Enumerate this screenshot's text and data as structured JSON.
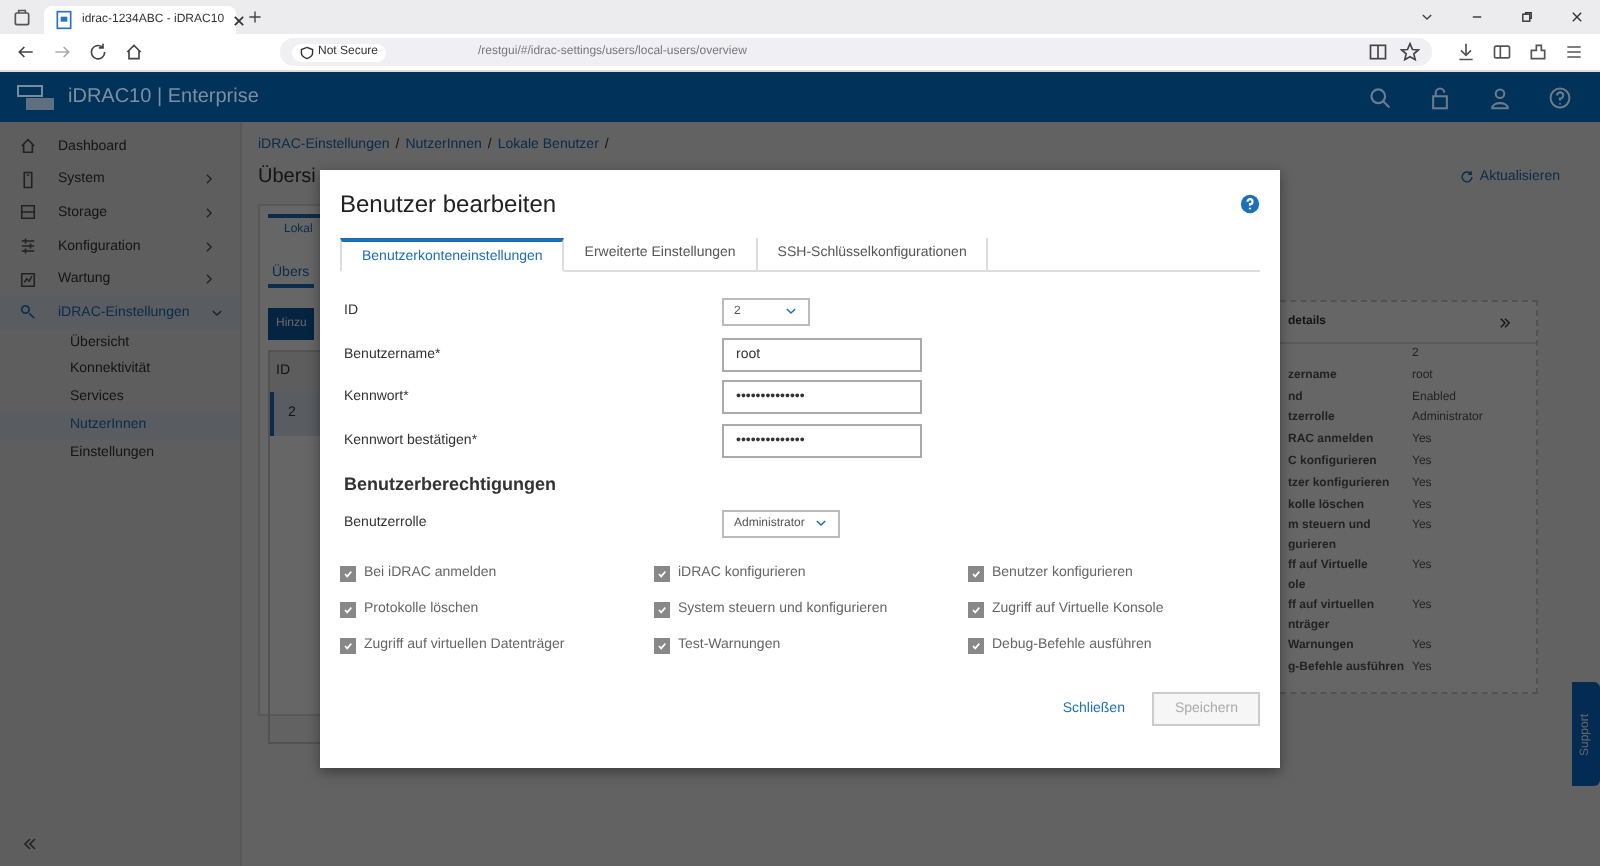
{
  "browser": {
    "tab_title": "idrac-1234ABC - iDRAC10",
    "security": "Not Secure",
    "url": "/restgui/#/idrac-settings/users/local-users/overview"
  },
  "header": {
    "product": "iDRAC10 | Enterprise"
  },
  "sidebar": {
    "items": [
      {
        "label": "Dashboard",
        "expandable": false,
        "selected": false
      },
      {
        "label": "System",
        "expandable": true,
        "expanded": false,
        "selected": false
      },
      {
        "label": "Storage",
        "expandable": true,
        "expanded": false,
        "selected": false
      },
      {
        "label": "Konfiguration",
        "expandable": true,
        "expanded": false,
        "selected": false
      },
      {
        "label": "Wartung",
        "expandable": true,
        "expanded": false,
        "selected": false
      },
      {
        "label": "iDRAC-Einstellungen",
        "expandable": true,
        "expanded": true,
        "selected": true,
        "children": [
          {
            "label": "Übersicht",
            "selected": false
          },
          {
            "label": "Konnektivität",
            "selected": false
          },
          {
            "label": "Services",
            "selected": false
          },
          {
            "label": "NutzerInnen",
            "selected": true
          },
          {
            "label": "Einstellungen",
            "selected": false
          }
        ]
      }
    ]
  },
  "breadcrumb": {
    "separator": "/",
    "items": [
      "iDRAC-Einstellungen",
      "NutzerInnen",
      "Lokale Benutzer"
    ]
  },
  "page": {
    "title": "Übersi",
    "refresh": "Aktualisieren",
    "tab": "Lokal",
    "subtab": "Übers",
    "add_button": "Hinzu",
    "table": {
      "header": "ID",
      "rows": [
        {
          "cell": "2",
          "selected": true
        }
      ]
    }
  },
  "details": {
    "title": "details",
    "rows": [
      {
        "label": "",
        "value": "2"
      },
      {
        "label": "zername",
        "value": "root"
      },
      {
        "label": "nd",
        "value": "Enabled"
      },
      {
        "label": "tzerrolle",
        "value": "Administrator"
      },
      {
        "label": "RAC anmelden",
        "value": "Yes"
      },
      {
        "label": "C konfigurieren",
        "value": "Yes"
      },
      {
        "label": "tzer konfigurieren",
        "value": "Yes"
      },
      {
        "label": "kolle löschen",
        "value": "Yes"
      },
      {
        "label": "m steuern und\ngurieren",
        "value": "Yes"
      },
      {
        "label": "ff auf Virtuelle\nole",
        "value": "Yes"
      },
      {
        "label": "ff auf virtuellen\nnträger",
        "value": "Yes"
      },
      {
        "label": "Warnungen",
        "value": "Yes"
      },
      {
        "label": "g-Befehle ausführen",
        "value": "Yes"
      }
    ]
  },
  "support": "Support",
  "dialog": {
    "title": "Benutzer bearbeiten",
    "tabs": [
      {
        "label": "Benutzerkonteneinstellungen",
        "selected": true
      },
      {
        "label": "Erweiterte Einstellungen",
        "selected": false
      },
      {
        "label": "SSH-Schlüsselkonfigurationen",
        "selected": false
      }
    ],
    "fields": [
      {
        "kind": "select",
        "label": "ID",
        "value": "2"
      },
      {
        "kind": "input",
        "label": "Benutzername*",
        "value": "root"
      },
      {
        "kind": "input",
        "label": "Kennwort*",
        "value": "••••••••••••••"
      },
      {
        "kind": "input",
        "label": "Kennwort bestätigen*",
        "value": "••••••••••••••"
      }
    ],
    "permissions_heading": "Benutzerberechtigungen",
    "role": {
      "label": "Benutzerrolle",
      "value": "Administrator"
    },
    "permissions": [
      {
        "label": "Bei iDRAC anmelden",
        "checked": true,
        "disabled": true
      },
      {
        "label": "iDRAC konfigurieren",
        "checked": true,
        "disabled": true
      },
      {
        "label": "Benutzer konfigurieren",
        "checked": true,
        "disabled": true
      },
      {
        "label": "Protokolle löschen",
        "checked": true,
        "disabled": true
      },
      {
        "label": "System steuern und konfigurieren",
        "checked": true,
        "disabled": true
      },
      {
        "label": "Zugriff auf Virtuelle Konsole",
        "checked": true,
        "disabled": true
      },
      {
        "label": "Zugriff auf virtuellen Datenträger",
        "checked": true,
        "disabled": true
      },
      {
        "label": "Test-Warnungen",
        "checked": true,
        "disabled": true
      },
      {
        "label": "Debug-Befehle ausführen",
        "checked": true,
        "disabled": true
      }
    ],
    "close": "Schließen",
    "save": {
      "label": "Speichern",
      "disabled": true
    }
  }
}
